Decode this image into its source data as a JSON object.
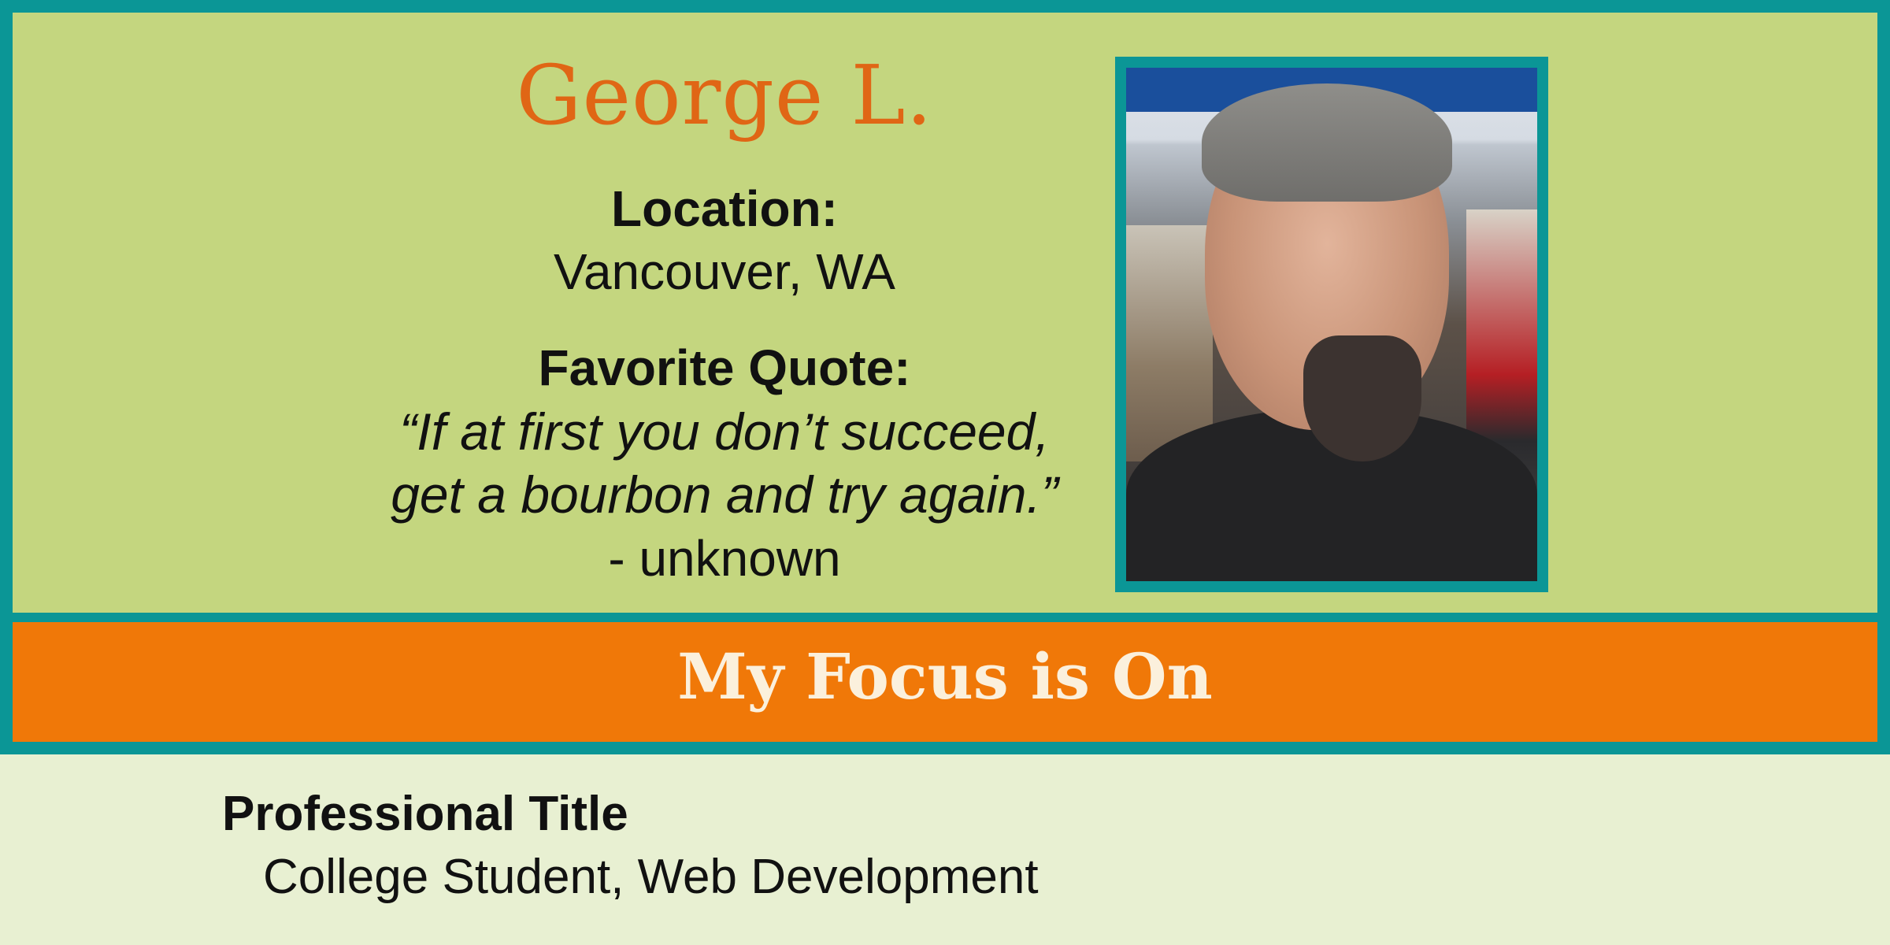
{
  "profile": {
    "name": "George L.",
    "location_label": "Location:",
    "location": "Vancouver, WA",
    "quote_label": "Favorite Quote:",
    "quote_line1": "“If at first you don’t succeed,",
    "quote_line2": "get a bourbon and try again.”",
    "quote_author": "- unknown"
  },
  "focus": {
    "heading": "My Focus is On"
  },
  "professional": {
    "label": "Professional Title",
    "value": "College Student, Web Development"
  },
  "colors": {
    "frame": "#0b9696",
    "top_background": "#c4d67f",
    "name_color": "#e06615",
    "band": "#f07808",
    "band_text": "#fbf0dc",
    "bottom_background": "#e8f0d2"
  },
  "photo": {
    "subject": "profile-photo"
  }
}
